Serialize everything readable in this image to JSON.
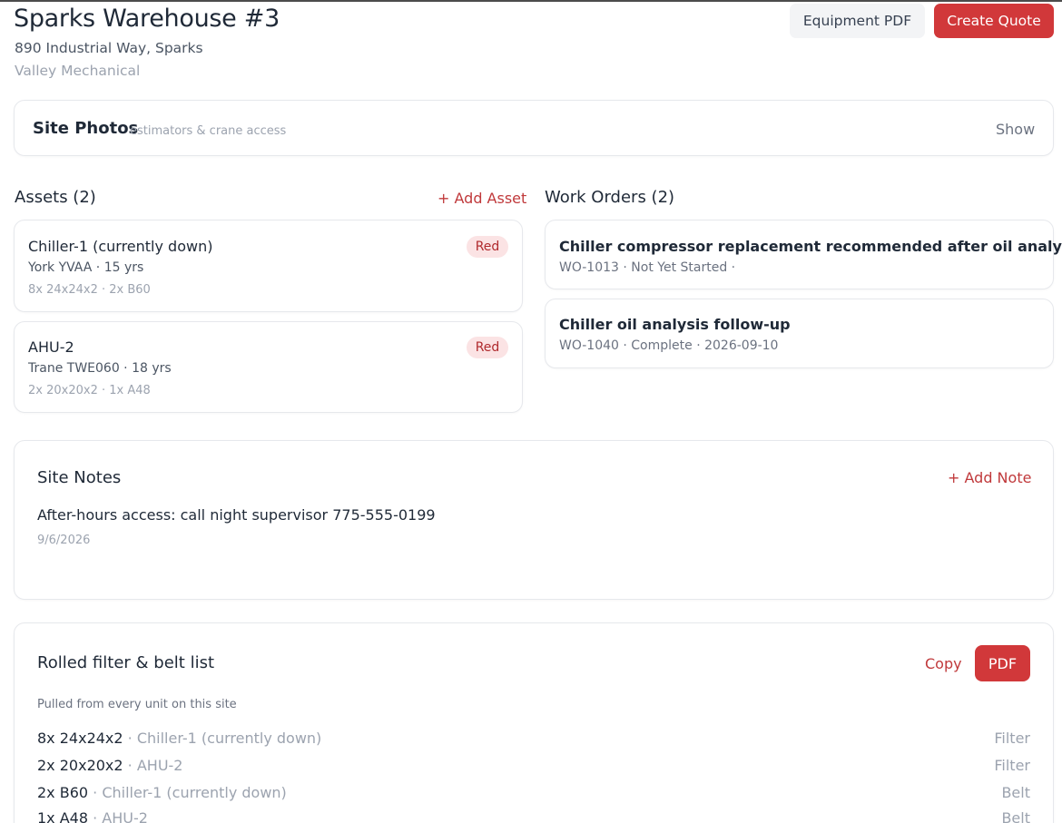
{
  "header": {
    "title": "Sparks Warehouse #3",
    "address": "890 Industrial Way, Sparks",
    "company": "Valley Mechanical",
    "equipment_pdf_label": "Equipment PDF",
    "create_quote_label": "Create Quote"
  },
  "photos": {
    "title": "Site Photos",
    "subtitle": "estimators & crane access",
    "show_label": "Show"
  },
  "assets": {
    "title": "Assets (2)",
    "add_label": "+ Add Asset",
    "items": [
      {
        "name": "Chiller-1 (currently down)",
        "model": "York YVAA · 15 yrs",
        "parts": "8x 24x24x2 · 2x B60",
        "badge": "Red"
      },
      {
        "name": "AHU-2",
        "model": "Trane TWE060 · 18 yrs",
        "parts": "2x 20x20x2 · 1x A48",
        "badge": "Red"
      }
    ]
  },
  "work_orders": {
    "title": "Work Orders (2)",
    "items": [
      {
        "title": "Chiller compressor replacement recommended after oil analysis.",
        "meta": "WO-1013 · Not Yet Started ·"
      },
      {
        "title": "Chiller oil analysis follow-up",
        "meta": "WO-1040 · Complete · 2026-09-10"
      }
    ]
  },
  "notes": {
    "title": "Site Notes",
    "add_label": "+ Add Note",
    "items": [
      {
        "text": "After-hours access: call night supervisor 775-555-0199",
        "date": "9/6/2026"
      }
    ]
  },
  "rolled_list": {
    "title": "Rolled filter & belt list",
    "copy_label": "Copy",
    "pdf_label": "PDF",
    "subtitle": "Pulled from every unit on this site",
    "items": [
      {
        "qty": "8x 24x24x2",
        "unit": " · Chiller-1 (currently down)",
        "type": "Filter"
      },
      {
        "qty": "2x 20x20x2",
        "unit": " · AHU-2",
        "type": "Filter"
      },
      {
        "qty": "2x B60",
        "unit": " · Chiller-1 (currently down)",
        "type": "Belt"
      },
      {
        "qty": "1x A48",
        "unit": " · AHU-2",
        "type": "Belt"
      }
    ]
  },
  "colors": {
    "accent": "#d1383a",
    "badge_bg": "#fbe3e4",
    "muted": "#9ca3af"
  }
}
